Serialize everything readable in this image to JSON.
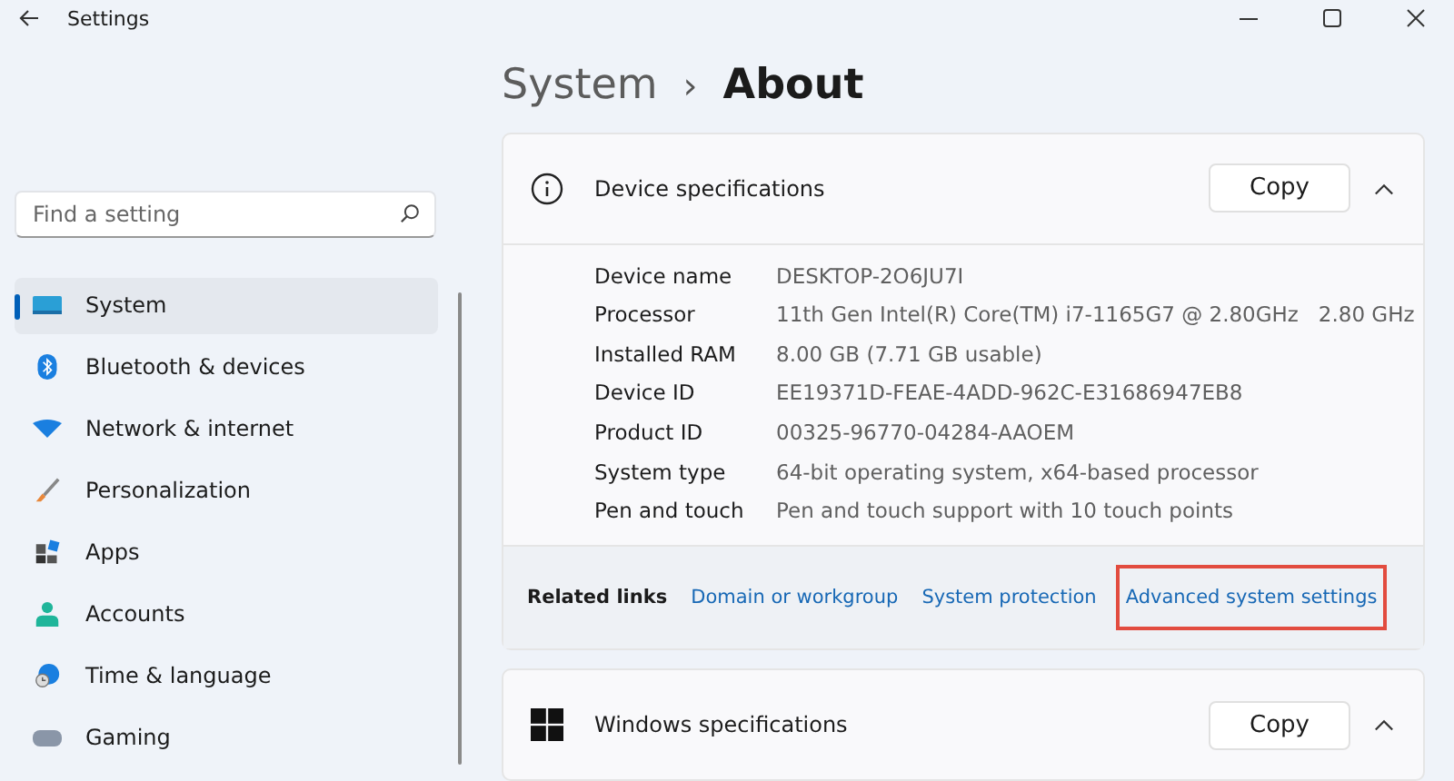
{
  "window": {
    "title": "Settings"
  },
  "breadcrumb": {
    "parent": "System",
    "separator": "›",
    "current": "About"
  },
  "search": {
    "placeholder": "Find a setting"
  },
  "sidebar": {
    "items": [
      {
        "label": "System",
        "selected": true
      },
      {
        "label": "Bluetooth & devices",
        "selected": false
      },
      {
        "label": "Network & internet",
        "selected": false
      },
      {
        "label": "Personalization",
        "selected": false
      },
      {
        "label": "Apps",
        "selected": false
      },
      {
        "label": "Accounts",
        "selected": false
      },
      {
        "label": "Time & language",
        "selected": false
      },
      {
        "label": "Gaming",
        "selected": false
      }
    ]
  },
  "device_specs": {
    "title": "Device specifications",
    "button": "Copy",
    "expanded": true,
    "rows": [
      {
        "label": "Device name",
        "value": "DESKTOP-2O6JU7I"
      },
      {
        "label": "Processor",
        "value": "11th Gen Intel(R) Core(TM) i7-1165G7 @ 2.80GHz   2.80 GHz"
      },
      {
        "label": "Installed RAM",
        "value": "8.00 GB (7.71 GB usable)"
      },
      {
        "label": "Device ID",
        "value": "EE19371D-FEAE-4ADD-962C-E31686947EB8"
      },
      {
        "label": "Product ID",
        "value": "00325-96770-04284-AAOEM"
      },
      {
        "label": "System type",
        "value": "64-bit operating system, x64-based processor"
      },
      {
        "label": "Pen and touch",
        "value": "Pen and touch support with 10 touch points"
      }
    ]
  },
  "related_links": {
    "label": "Related links",
    "links": [
      {
        "text": "Domain or workgroup",
        "highlighted": false
      },
      {
        "text": "System protection",
        "highlighted": false
      },
      {
        "text": "Advanced system settings",
        "highlighted": true
      }
    ]
  },
  "windows_specs": {
    "title": "Windows specifications",
    "button": "Copy",
    "expanded": true
  }
}
